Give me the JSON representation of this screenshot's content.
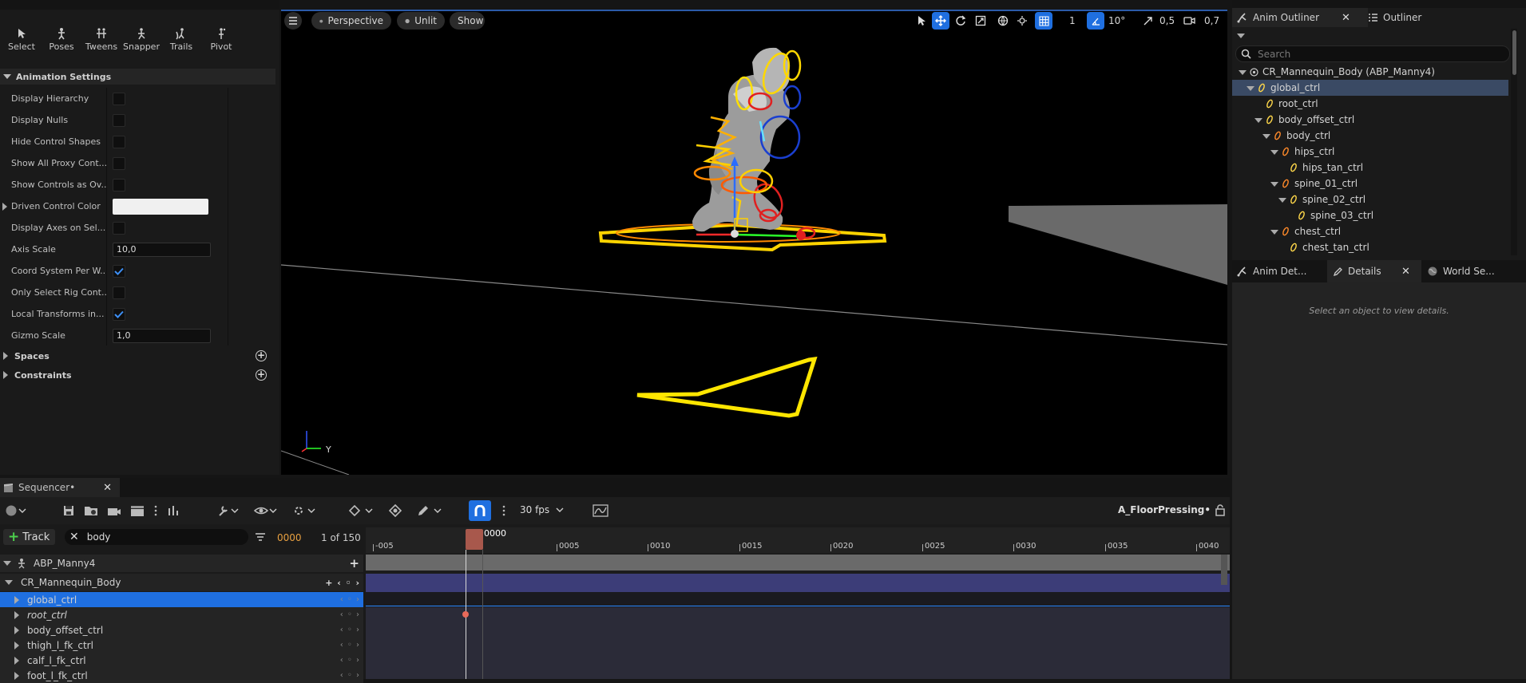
{
  "modes": [
    {
      "label": "Select",
      "icon": "select-icon"
    },
    {
      "label": "Poses",
      "icon": "poses-icon"
    },
    {
      "label": "Tweens",
      "icon": "tweens-icon"
    },
    {
      "label": "Snapper",
      "icon": "snapper-icon"
    },
    {
      "label": "Trails",
      "icon": "trails-icon"
    },
    {
      "label": "Pivot",
      "icon": "pivot-icon"
    }
  ],
  "anim_settings": {
    "header": "Animation Settings",
    "rows": [
      {
        "label": "Display Hierarchy",
        "type": "checkbox",
        "checked": false
      },
      {
        "label": "Display Nulls",
        "type": "checkbox",
        "checked": false
      },
      {
        "label": "Hide Control Shapes",
        "type": "checkbox",
        "checked": false
      },
      {
        "label": "Show All Proxy Cont...",
        "type": "checkbox",
        "checked": false
      },
      {
        "label": "Show Controls as Ov...",
        "type": "checkbox",
        "checked": false
      },
      {
        "label": "Driven Control Color",
        "type": "color",
        "color": "#f0f0f0"
      },
      {
        "label": "Display Axes on Sel...",
        "type": "checkbox",
        "checked": false
      },
      {
        "label": "Axis Scale",
        "type": "number",
        "value": "10,0"
      },
      {
        "label": "Coord System Per W...",
        "type": "checkbox",
        "checked": true
      },
      {
        "label": "Only Select Rig Cont...",
        "type": "checkbox",
        "checked": false
      },
      {
        "label": "Local Transforms in...",
        "type": "checkbox",
        "checked": true
      },
      {
        "label": "Gizmo Scale",
        "type": "number",
        "value": "1,0"
      }
    ],
    "spaces": "Spaces",
    "constraints": "Constraints"
  },
  "viewport": {
    "perspective": "Perspective",
    "unlit": "Unlit",
    "show": "Show",
    "grid_value": "1",
    "angle_value": "10°",
    "scale_value": "0,5",
    "camera_value": "0,7",
    "axis_label": "Y"
  },
  "outliner": {
    "tab_anim_outliner": "Anim Outliner",
    "tab_outliner": "Outliner",
    "search_placeholder": "Search",
    "items": [
      {
        "label": "CR_Mannequin_Body  (ABP_Manny4)",
        "depth": 0,
        "expand": "down",
        "icon": "rig-icon",
        "selected": false
      },
      {
        "label": "global_ctrl",
        "depth": 1,
        "expand": "down",
        "icon": "control-icon",
        "selected": true
      },
      {
        "label": "root_ctrl",
        "depth": 2,
        "expand": "none",
        "icon": "control-icon",
        "selected": false
      },
      {
        "label": "body_offset_ctrl",
        "depth": 2,
        "expand": "down",
        "icon": "control-icon",
        "selected": false
      },
      {
        "label": "body_ctrl",
        "depth": 3,
        "expand": "down",
        "icon": "control-icon",
        "selected": false
      },
      {
        "label": "hips_ctrl",
        "depth": 4,
        "expand": "down",
        "icon": "control-icon",
        "selected": false
      },
      {
        "label": "hips_tan_ctrl",
        "depth": 5,
        "expand": "none",
        "icon": "control-icon",
        "selected": false
      },
      {
        "label": "spine_01_ctrl",
        "depth": 4,
        "expand": "down",
        "icon": "control-icon",
        "selected": false
      },
      {
        "label": "spine_02_ctrl",
        "depth": 5,
        "expand": "down",
        "icon": "control-icon",
        "selected": false
      },
      {
        "label": "spine_03_ctrl",
        "depth": 6,
        "expand": "none",
        "icon": "control-icon",
        "selected": false
      },
      {
        "label": "chest_ctrl",
        "depth": 4,
        "expand": "down",
        "icon": "control-icon",
        "selected": false
      },
      {
        "label": "chest_tan_ctrl",
        "depth": 5,
        "expand": "none",
        "icon": "control-icon",
        "selected": false
      }
    ]
  },
  "details": {
    "tab_anim_details": "Anim Det...",
    "tab_details": "Details",
    "tab_world": "World Se...",
    "empty_text": "Select an object to view details."
  },
  "sequencer": {
    "tab_title": "Sequencer•",
    "fps": "30 fps",
    "sequence_name": "A_FloorPressing•",
    "track_button": "Track",
    "filter_text": "body",
    "current_frame": "0000",
    "count": "1 of 150",
    "playhead_label": "0000",
    "ticks": [
      "-005",
      "0005",
      "0010",
      "0015",
      "0020",
      "0025",
      "0030",
      "0035",
      "0040"
    ],
    "tracks": [
      {
        "label": "ABP_Manny4",
        "depth": 0,
        "type": "actor",
        "selected": false
      },
      {
        "label": "CR_Mannequin_Body",
        "depth": 1,
        "type": "rig",
        "selected": false
      },
      {
        "label": "global_ctrl",
        "depth": 2,
        "type": "control",
        "selected": true
      },
      {
        "label": "root_ctrl",
        "depth": 2,
        "type": "control",
        "selected": false
      },
      {
        "label": "body_offset_ctrl",
        "depth": 2,
        "type": "control",
        "selected": false
      },
      {
        "label": "thigh_l_fk_ctrl",
        "depth": 2,
        "type": "control",
        "selected": false
      },
      {
        "label": "calf_l_fk_ctrl",
        "depth": 2,
        "type": "control",
        "selected": false
      },
      {
        "label": "foot_l_fk_ctrl",
        "depth": 2,
        "type": "control",
        "selected": false
      }
    ]
  }
}
